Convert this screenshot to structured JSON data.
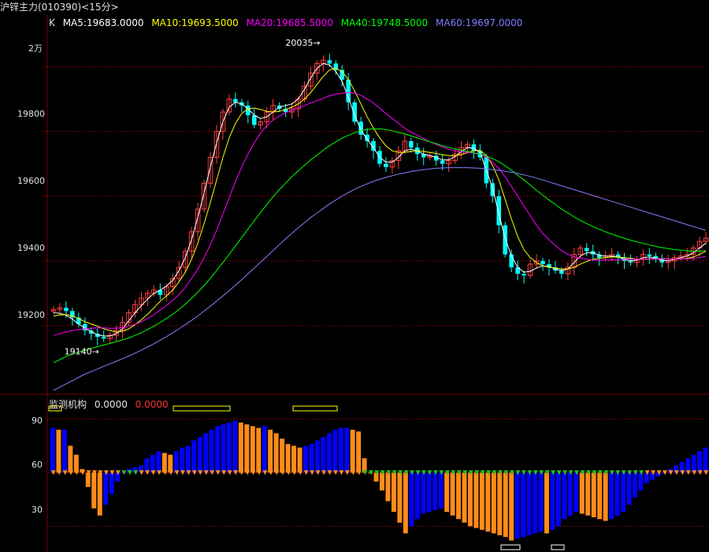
{
  "header": {
    "title": "沪锌主力(010390)<15分>"
  },
  "legend": {
    "k_label": "K",
    "items": [
      {
        "label": "MA5:19683.0000",
        "color": "#ffffff"
      },
      {
        "label": "MA10:19693.5000",
        "color": "#ffff00"
      },
      {
        "label": "MA20:19685.5000",
        "color": "#ff00ff"
      },
      {
        "label": "MA40:19748.5000",
        "color": "#00ff00"
      },
      {
        "label": "MA60:19697.0000",
        "color": "#8080ff"
      }
    ]
  },
  "annotations": {
    "high": "20035",
    "low": "19140"
  },
  "sub_panel": {
    "title": "监测机构",
    "value1": "0.0000",
    "value2": "0.0000"
  },
  "colors": {
    "grid": "#7a0000",
    "up": "#ff4040",
    "down": "#00ffff",
    "bar_orange": "#ff8c1a",
    "bar_blue": "#0000ff",
    "marker_green": "#20c020"
  },
  "chart_data": [
    {
      "type": "candlestick",
      "title": "沪锌主力(010390)<15分>",
      "yaxis_labels": [
        "2万",
        "19800",
        "19600",
        "19400",
        "19200"
      ],
      "ylim": [
        19000,
        20150
      ],
      "high_marker": 20035,
      "low_marker": 19140,
      "close_series": [
        19250,
        19255,
        19245,
        19225,
        19205,
        19185,
        19175,
        19165,
        19160,
        19170,
        19185,
        19210,
        19240,
        19265,
        19285,
        19300,
        19310,
        19295,
        19320,
        19345,
        19380,
        19430,
        19490,
        19560,
        19640,
        19720,
        19800,
        19860,
        19900,
        19890,
        19880,
        19850,
        19820,
        19830,
        19860,
        19880,
        19870,
        19860,
        19870,
        19900,
        19940,
        19980,
        20010,
        20020,
        20010,
        19990,
        19960,
        19890,
        19830,
        19790,
        19770,
        19740,
        19700,
        19690,
        19710,
        19740,
        19770,
        19750,
        19730,
        19720,
        19725,
        19710,
        19700,
        19710,
        19730,
        19750,
        19760,
        19740,
        19720,
        19640,
        19600,
        19510,
        19420,
        19380,
        19360,
        19355,
        19390,
        19400,
        19390,
        19380,
        19370,
        19360,
        19380,
        19420,
        19440,
        19430,
        19420,
        19410,
        19415,
        19420,
        19410,
        19400,
        19395,
        19405,
        19420,
        19415,
        19405,
        19395,
        19400,
        19410,
        19415,
        19420,
        19440,
        19460,
        19470
      ],
      "ma5": [
        19240,
        19238,
        19232,
        19220,
        19205,
        19192,
        19182,
        19172,
        19168,
        19168,
        19175,
        19190,
        19215,
        19240,
        19262,
        19282,
        19300,
        19310,
        19322,
        19340,
        19370,
        19410,
        19465,
        19535,
        19610,
        19690,
        19765,
        19830,
        19875,
        19890,
        19885,
        19870,
        19850,
        19840,
        19845,
        19860,
        19875,
        19880,
        19885,
        19900,
        19930,
        19965,
        19995,
        20010,
        20005,
        19985,
        19955,
        19905,
        19850,
        19805,
        19775,
        19750,
        19720,
        19705,
        19705,
        19720,
        19740,
        19745,
        19740,
        19730,
        19725,
        19720,
        19712,
        19712,
        19722,
        19738,
        19750,
        19748,
        19735,
        19680,
        19625,
        19545,
        19470,
        19415,
        19380,
        19365,
        19368,
        19378,
        19385,
        19382,
        19375,
        19370,
        19375,
        19395,
        19415,
        19425,
        19425,
        19418,
        19415,
        19415,
        19412,
        19405,
        19400,
        19402,
        19410,
        19412,
        19408,
        19402,
        19400,
        19405,
        19410,
        19415,
        19425,
        19440,
        19455
      ],
      "ma10": [
        19230,
        19233,
        19234,
        19230,
        19222,
        19212,
        19205,
        19198,
        19190,
        19185,
        19180,
        19182,
        19190,
        19203,
        19218,
        19235,
        19255,
        19275,
        19292,
        19310,
        19335,
        19365,
        19405,
        19455,
        19515,
        19580,
        19650,
        19720,
        19780,
        19825,
        19855,
        19870,
        19872,
        19868,
        19862,
        19860,
        19862,
        19868,
        19875,
        19885,
        19900,
        19920,
        19945,
        19970,
        19990,
        19995,
        19985,
        19960,
        19925,
        19885,
        19845,
        19810,
        19780,
        19755,
        19740,
        19735,
        19735,
        19738,
        19740,
        19738,
        19735,
        19732,
        19728,
        19725,
        19725,
        19728,
        19735,
        19740,
        19742,
        19725,
        19695,
        19650,
        19590,
        19530,
        19475,
        19435,
        19410,
        19395,
        19385,
        19380,
        19378,
        19375,
        19375,
        19380,
        19390,
        19398,
        19405,
        19408,
        19410,
        19412,
        19412,
        19410,
        19408,
        19405,
        19405,
        19406,
        19407,
        19407,
        19406,
        19405,
        19406,
        19408,
        19412,
        19420,
        19430
      ],
      "ma20": [
        19170,
        19175,
        19180,
        19185,
        19188,
        19190,
        19192,
        19193,
        19193,
        19192,
        19192,
        19194,
        19198,
        19204,
        19212,
        19222,
        19234,
        19248,
        19262,
        19278,
        19296,
        19318,
        19345,
        19375,
        19410,
        19450,
        19495,
        19545,
        19595,
        19645,
        19690,
        19730,
        19765,
        19795,
        19818,
        19835,
        19848,
        19858,
        19865,
        19872,
        19880,
        19888,
        19895,
        19902,
        19910,
        19915,
        19918,
        19920,
        19918,
        19912,
        19900,
        19888,
        19872,
        19855,
        19840,
        19825,
        19810,
        19798,
        19788,
        19778,
        19768,
        19760,
        19752,
        19745,
        19740,
        19737,
        19735,
        19733,
        19730,
        19720,
        19705,
        19685,
        19660,
        19630,
        19600,
        19570,
        19540,
        19510,
        19485,
        19465,
        19448,
        19432,
        19420,
        19412,
        19408,
        19405,
        19403,
        19402,
        19402,
        19403,
        19404,
        19405,
        19405,
        19405,
        19405,
        19405,
        19406,
        19406,
        19406,
        19406,
        19406,
        19407,
        19408,
        19410,
        19414
      ],
      "ma40": [
        19085,
        19095,
        19105,
        19112,
        19118,
        19124,
        19130,
        19135,
        19140,
        19145,
        19150,
        19156,
        19162,
        19170,
        19178,
        19188,
        19198,
        19210,
        19222,
        19235,
        19250,
        19266,
        19284,
        19303,
        19324,
        19346,
        19370,
        19395,
        19420,
        19446,
        19472,
        19498,
        19524,
        19550,
        19574,
        19598,
        19620,
        19640,
        19660,
        19678,
        19695,
        19712,
        19727,
        19742,
        19756,
        19768,
        19779,
        19788,
        19796,
        19802,
        19806,
        19808,
        19808,
        19806,
        19802,
        19797,
        19792,
        19786,
        19780,
        19774,
        19768,
        19762,
        19756,
        19751,
        19746,
        19742,
        19738,
        19734,
        19730,
        19724,
        19716,
        19706,
        19694,
        19680,
        19665,
        19650,
        19634,
        19618,
        19603,
        19588,
        19574,
        19560,
        19548,
        19536,
        19525,
        19515,
        19506,
        19498,
        19490,
        19483,
        19476,
        19470,
        19464,
        19459,
        19454,
        19449,
        19445,
        19441,
        19438,
        19435,
        19433,
        19431,
        19430,
        19430,
        19432
      ],
      "ma60": [
        19000,
        19010,
        19020,
        19030,
        19040,
        19050,
        19058,
        19066,
        19074,
        19082,
        19090,
        19098,
        19106,
        19115,
        19124,
        19134,
        19144,
        19155,
        19166,
        19178,
        19190,
        19203,
        19216,
        19230,
        19245,
        19260,
        19276,
        19292,
        19308,
        19325,
        19342,
        19360,
        19378,
        19396,
        19414,
        19432,
        19450,
        19468,
        19485,
        19502,
        19518,
        19534,
        19548,
        19562,
        19576,
        19588,
        19600,
        19611,
        19621,
        19630,
        19638,
        19646,
        19652,
        19658,
        19663,
        19668,
        19672,
        19676,
        19679,
        19682,
        19684,
        19686,
        19687,
        19688,
        19688,
        19688,
        19688,
        19687,
        19686,
        19684,
        19682,
        19680,
        19677,
        19674,
        19670,
        19666,
        19661,
        19656,
        19650,
        19644,
        19638,
        19632,
        19626,
        19620,
        19614,
        19608,
        19602,
        19596,
        19590,
        19584,
        19578,
        19572,
        19566,
        19560,
        19554,
        19548,
        19542,
        19536,
        19530,
        19524,
        19518,
        19512,
        19506,
        19500,
        19494
      ]
    },
    {
      "type": "bar",
      "title": "监测机构",
      "yaxis_labels": [
        "90",
        "60",
        "30"
      ],
      "ylim": [
        20,
        95
      ],
      "baseline": 60,
      "values": [
        85,
        84,
        84,
        75,
        70,
        62,
        52,
        40,
        36,
        42,
        48,
        55,
        60,
        62,
        63,
        64,
        68,
        70,
        72,
        71,
        70,
        72,
        74,
        75,
        78,
        80,
        82,
        84,
        86,
        87,
        88,
        89,
        88,
        87,
        86,
        85,
        86,
        84,
        82,
        79,
        76,
        75,
        74,
        75,
        76,
        78,
        80,
        82,
        84,
        85,
        85,
        84,
        83,
        68,
        60,
        55,
        50,
        44,
        38,
        32,
        26,
        30,
        34,
        37,
        38,
        39,
        40,
        38,
        36,
        34,
        32,
        30,
        29,
        28,
        27,
        26,
        25,
        24,
        22,
        23,
        24,
        25,
        26,
        27,
        26,
        28,
        30,
        34,
        36,
        38,
        37,
        36,
        35,
        34,
        33,
        34,
        36,
        38,
        42,
        46,
        50,
        54,
        56,
        58,
        60,
        62,
        64,
        66,
        68,
        70,
        72,
        74
      ]
    }
  ]
}
